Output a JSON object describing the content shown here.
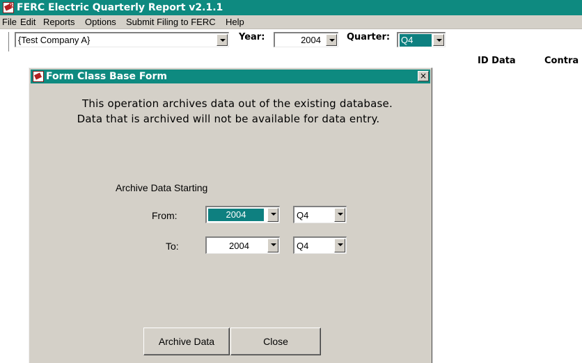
{
  "app": {
    "title": "FERC Electric Quarterly Report v2.1.1"
  },
  "menu": [
    "File",
    "Edit",
    "Reports",
    "Options",
    "Submit Filing to FERC",
    "Help"
  ],
  "toolbar": {
    "company_value": "{Test Company A}",
    "year_label": "Year:",
    "year_value": "2004",
    "quarter_label": "Quarter:",
    "quarter_value": "Q4",
    "id_data_label": "ID Data",
    "contracts_label": "Contra"
  },
  "dialog": {
    "title": "Form Class Base Form",
    "close_symbol": "×",
    "message_line1": "This operation archives data out of the existing database.",
    "message_line2": "Data that is archived will not be available for data entry.",
    "section_label": "Archive Data Starting",
    "from_label": "From:",
    "from_year": "2004",
    "from_quarter": "Q4",
    "to_label": "To:",
    "to_year": "2004",
    "to_quarter": "Q4",
    "archive_button": "Archive Data",
    "close_button": "Close"
  },
  "colors": {
    "titlebar": "#0e8a80",
    "selection": "#0e8080",
    "dialog_face": "#d4d0c8"
  }
}
